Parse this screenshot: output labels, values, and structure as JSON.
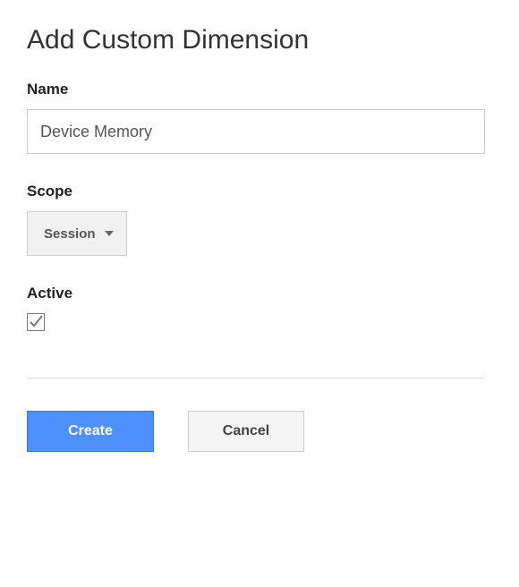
{
  "title": "Add Custom Dimension",
  "name": {
    "label": "Name",
    "value": "Device Memory"
  },
  "scope": {
    "label": "Scope",
    "selected": "Session"
  },
  "active": {
    "label": "Active",
    "checked": true
  },
  "buttons": {
    "create": "Create",
    "cancel": "Cancel"
  }
}
